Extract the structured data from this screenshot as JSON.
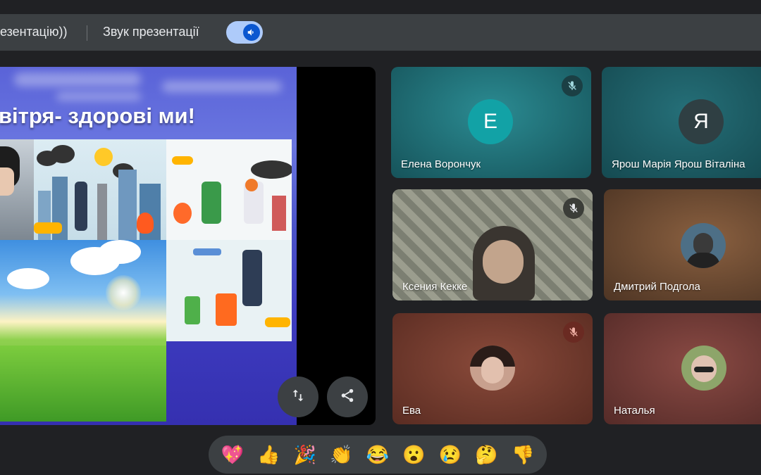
{
  "toolbar": {
    "presentation_label_partial": "езентацію))",
    "audio_label": "Звук презентації",
    "audio_toggle_on": true
  },
  "slide": {
    "title_partial": "вітря- здорові ми!"
  },
  "controls": {
    "swap_icon": "swap-vertical-icon",
    "share_icon": "share-icon"
  },
  "participants": [
    {
      "name": "Елена Ворончук",
      "initial": "Е",
      "muted": true,
      "bg": "#1f6f78",
      "avatar_bg": "#14a3a8"
    },
    {
      "name": "Ярош Марія Ярош Віталіна",
      "initial": "Я",
      "muted": false,
      "bg": "#1d5d66",
      "avatar_bg": "#2f3f43"
    },
    {
      "name": "Ксения Кекке",
      "initial": "",
      "muted": true,
      "bg": "#7a7f70",
      "avatar_bg": ""
    },
    {
      "name": "Дмитрий Подгола",
      "initial": "",
      "muted": false,
      "bg": "#6b4a34",
      "avatar_bg": "#4d6f86"
    },
    {
      "name": "Ева",
      "initial": "",
      "muted": true,
      "bg": "#6e3a2e",
      "avatar_bg": "#c8a08e"
    },
    {
      "name": "Наталья",
      "initial": "",
      "muted": false,
      "bg": "#6a3a36",
      "avatar_bg": "#8da56a"
    }
  ],
  "reactions": [
    "💖",
    "👍",
    "🎉",
    "👏",
    "😂",
    "😮",
    "😢",
    "🤔",
    "👎"
  ]
}
